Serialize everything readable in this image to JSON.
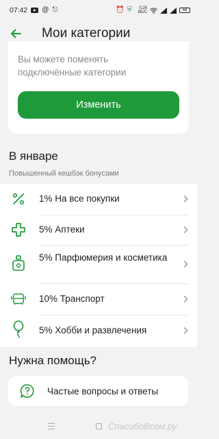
{
  "status_bar": {
    "time": "07:42",
    "speed": "0,26 КБ/С",
    "battery": "68"
  },
  "header": {
    "title": "Мои категории"
  },
  "top_card": {
    "description": "Вы можете поменять подключённые категории",
    "button_label": "Изменить"
  },
  "january": {
    "title": "В январе",
    "subtitle": "Повышенный кешбэк бонусами",
    "items": [
      {
        "label": "1% На все покупки",
        "icon": "percent-icon"
      },
      {
        "label": "5% Аптеки",
        "icon": "cross-icon"
      },
      {
        "label": "5% Парфюмерия и косметика",
        "icon": "perfume-icon"
      },
      {
        "label": "10% Транспорт",
        "icon": "bus-icon"
      },
      {
        "label": "5% Хобби и развлечения",
        "icon": "balloon-icon"
      }
    ]
  },
  "help": {
    "title": "Нужна помощь?",
    "faq_label": "Частые вопросы и ответы"
  },
  "watermark": "СпасибоВсем.ру",
  "colors": {
    "accent": "#1f9a3b",
    "background": "#f2f2f2",
    "card": "#ffffff"
  }
}
